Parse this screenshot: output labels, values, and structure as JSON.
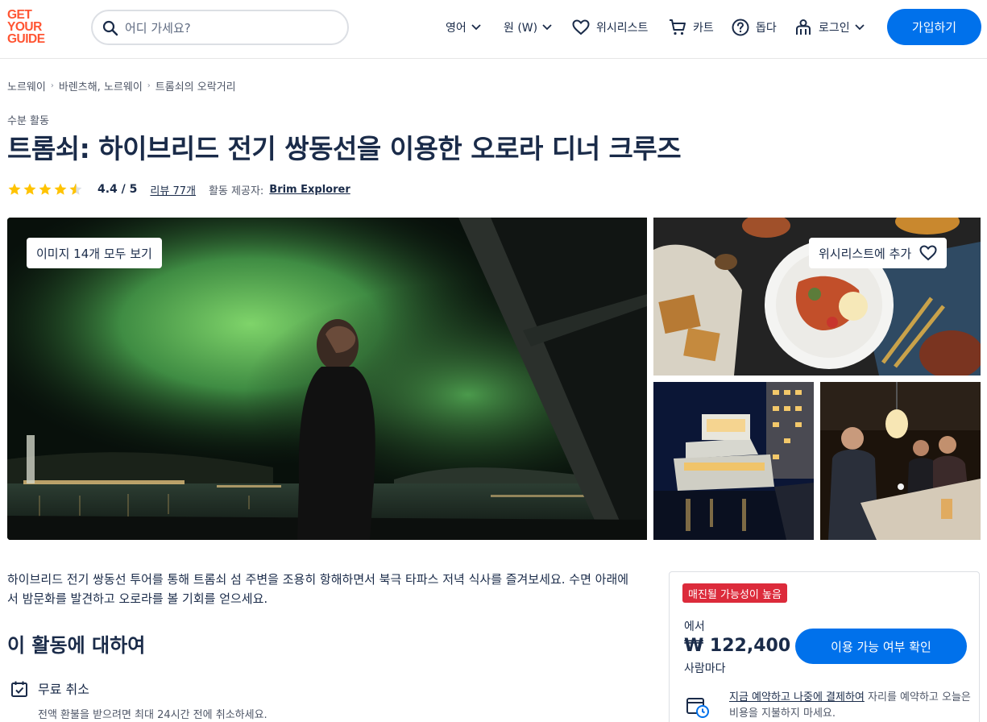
{
  "header": {
    "logo_lines": [
      "GET",
      "YOUR",
      "GUIDE"
    ],
    "search_placeholder": "어디 가세요?",
    "language": "영어",
    "currency": "원 (W)",
    "wishlist": "위시리스트",
    "cart": "카트",
    "help": "돕다",
    "login": "로그인",
    "signup": "가입하기"
  },
  "breadcrumb": [
    "노르웨이",
    "바렌츠해, 노르웨이",
    "트롬쇠의 오락거리"
  ],
  "activity": {
    "category": "수분 활동",
    "title": "트롬쇠: 하이브리드 전기 쌍동선을 이용한 오로라 디너 크루즈",
    "rating_stars": 4.4,
    "rating_text": "4.4 / 5",
    "reviews": "리뷰 77개",
    "provider_label": "활동 제공자:",
    "provider": "Brim Explorer"
  },
  "gallery": {
    "view_all": "이미지 14개 모두 보기",
    "add_to_wishlist": "위시리스트에 추가"
  },
  "description": "하이브리드 전기 쌍동선 투어를 통해 트롬쇠 섬 주변을 조용히 항해하면서 북극 타파스 저녁 식사를 즐겨보세요. 수면 아래에서 밤문화를 발견하고 오로라를 볼 기회를 얻으세요.",
  "about": {
    "heading": "이 활동에 대하여",
    "free_cancel_title": "무료 취소",
    "free_cancel_desc": "전액 환불을 받으려면 최대 24시간 전에 취소하세요."
  },
  "booking": {
    "badge": "매진될 가능성이 높음",
    "from": "에서",
    "price": "₩ 122,400",
    "per_person": "사람마다",
    "check_button": "이용 가능 여부 확인",
    "reserve_link": "지금 예약하고 나중에 결제하여",
    "reserve_rest": " 자리를 예약하고 오늘은 비용을 지불하지 마세요."
  },
  "colors": {
    "brand": "#ff5533",
    "primary_button": "#0071eb",
    "badge": "#dc2b3b",
    "star": "#ffc300",
    "text": "#1a2b49"
  }
}
